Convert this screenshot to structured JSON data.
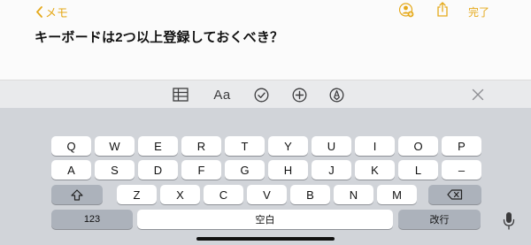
{
  "nav": {
    "back_label": "メモ",
    "done_label": "完了"
  },
  "note": {
    "title": "キーボードは2つ以上登録しておくべき？"
  },
  "toolbar": {
    "format_label": "Aa",
    "items": [
      "table-icon",
      "text-format",
      "checklist-icon",
      "add-icon",
      "markup-icon",
      "close-icon"
    ]
  },
  "keyboard": {
    "row1": [
      "Q",
      "W",
      "E",
      "R",
      "T",
      "Y",
      "U",
      "I",
      "O",
      "P"
    ],
    "row2": [
      "A",
      "S",
      "D",
      "F",
      "G",
      "H",
      "J",
      "K",
      "L",
      "–"
    ],
    "row3": [
      "Z",
      "X",
      "C",
      "V",
      "B",
      "N",
      "M"
    ],
    "numbers_label": "123",
    "space_label": "空白",
    "return_label": "改行"
  },
  "colors": {
    "accent": "#e5a91a",
    "keyboard_bg": "#d1d4d9",
    "function_key": "#acb2bb"
  }
}
